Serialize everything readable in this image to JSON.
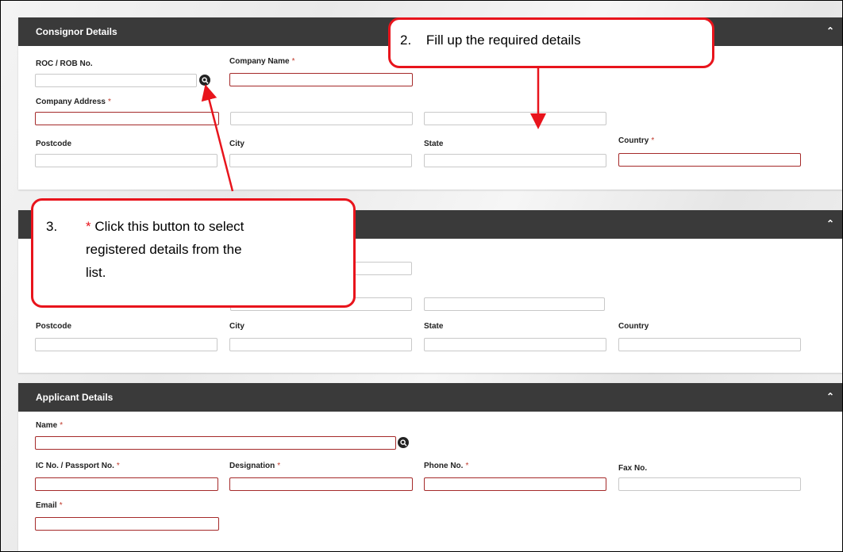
{
  "consignor": {
    "title": "Consignor Details",
    "roc_label": "ROC / ROB No.",
    "company_name_label": "Company Name",
    "company_address_label": "Company Address",
    "postcode_label": "Postcode",
    "city_label": "City",
    "state_label": "State",
    "country_label": "Country",
    "required_mark": "*"
  },
  "consignee": {
    "postcode_label": "Postcode",
    "city_label": "City",
    "state_label": "State",
    "country_label": "Country"
  },
  "applicant": {
    "title": "Applicant Details",
    "name_label": "Name",
    "ic_label": "IC No. / Passport No.",
    "designation_label": "Designation",
    "phone_label": "Phone No.",
    "fax_label": "Fax No.",
    "email_label": "Email",
    "required_mark": "*"
  },
  "callouts": {
    "step2_num": "2.",
    "step2_text": "Fill up the required details",
    "step3_num": "3.",
    "step3_star": "*",
    "step3_text1": "Click this button to select",
    "step3_text2": "registered details from the",
    "step3_text3": "list."
  },
  "icons": {
    "collapse": "chevron-up-icon",
    "search": "search-icon"
  },
  "colors": {
    "header_bg": "#3a3a3a",
    "required_border": "#a52a2a",
    "annotation_red": "#e8141c"
  }
}
